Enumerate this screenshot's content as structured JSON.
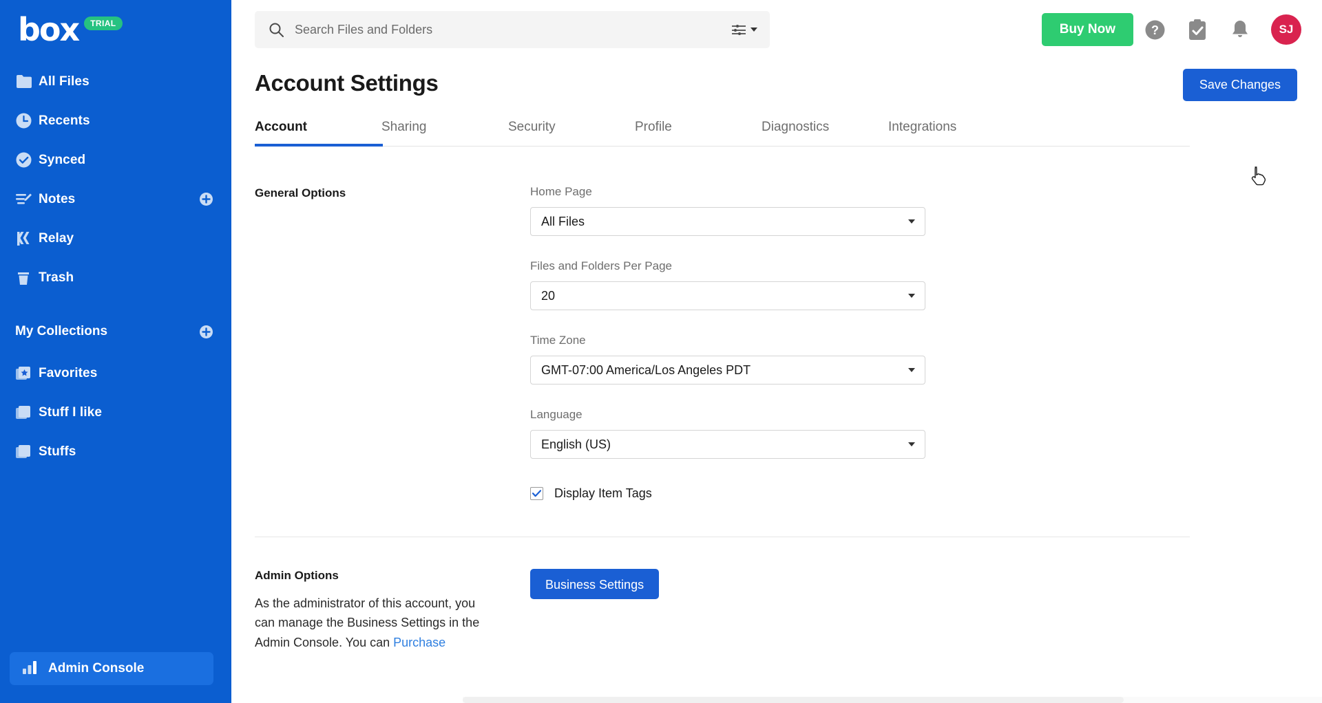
{
  "sidebar": {
    "logo_text": "box",
    "trial_badge": "TRIAL",
    "items": [
      {
        "label": "All Files",
        "icon": "folder-icon",
        "plus": false
      },
      {
        "label": "Recents",
        "icon": "clock-icon",
        "plus": false
      },
      {
        "label": "Synced",
        "icon": "check-circle-icon",
        "plus": false
      },
      {
        "label": "Notes",
        "icon": "notes-icon",
        "plus": true
      },
      {
        "label": "Relay",
        "icon": "relay-icon",
        "plus": false
      },
      {
        "label": "Trash",
        "icon": "trash-icon",
        "plus": false
      }
    ],
    "collections_title": "My Collections",
    "collections": [
      {
        "label": "Favorites",
        "icon": "favorites-star-icon"
      },
      {
        "label": "Stuff I like",
        "icon": "collection-icon"
      },
      {
        "label": "Stuffs",
        "icon": "collection-icon"
      }
    ],
    "admin_console_label": "Admin Console",
    "admin_console_icon": "bar-chart-icon"
  },
  "topbar": {
    "search_placeholder": "Search Files and Folders",
    "search_value": "",
    "search_icon": "search-icon",
    "filter_icon": "sliders-icon",
    "buy_now_label": "Buy Now",
    "help_icon": "help-circle-icon",
    "tasks_icon": "clipboard-check-icon",
    "notifications_icon": "bell-icon",
    "avatar_initials": "SJ"
  },
  "page": {
    "title": "Account Settings",
    "save_label": "Save Changes",
    "tabs": [
      {
        "label": "Account",
        "active": true
      },
      {
        "label": "Sharing",
        "active": false
      },
      {
        "label": "Security",
        "active": false
      },
      {
        "label": "Profile",
        "active": false
      },
      {
        "label": "Diagnostics",
        "active": false
      },
      {
        "label": "Integrations",
        "active": false
      }
    ]
  },
  "general_options": {
    "section_label": "General Options",
    "home_page": {
      "label": "Home Page",
      "value": "All Files"
    },
    "per_page": {
      "label": "Files and Folders Per Page",
      "value": "20"
    },
    "time_zone": {
      "label": "Time Zone",
      "value": "GMT-07:00 America/Los Angeles PDT"
    },
    "language": {
      "label": "Language",
      "value": "English (US)"
    },
    "display_tags": {
      "label": "Display Item Tags",
      "checked": true
    }
  },
  "admin_options": {
    "title": "Admin Options",
    "button_label": "Business Settings",
    "text_before": "As the administrator of this account, you can manage the Business Settings in the Admin Console. You can ",
    "link_label": "Purchase"
  },
  "colors": {
    "sidebar_blue": "#0b5ed0",
    "accent_blue": "#1a5fd4",
    "buy_green": "#2ecc71",
    "trial_green": "#26c281",
    "avatar_red": "#d9234f",
    "link_blue": "#2f7fe0"
  }
}
